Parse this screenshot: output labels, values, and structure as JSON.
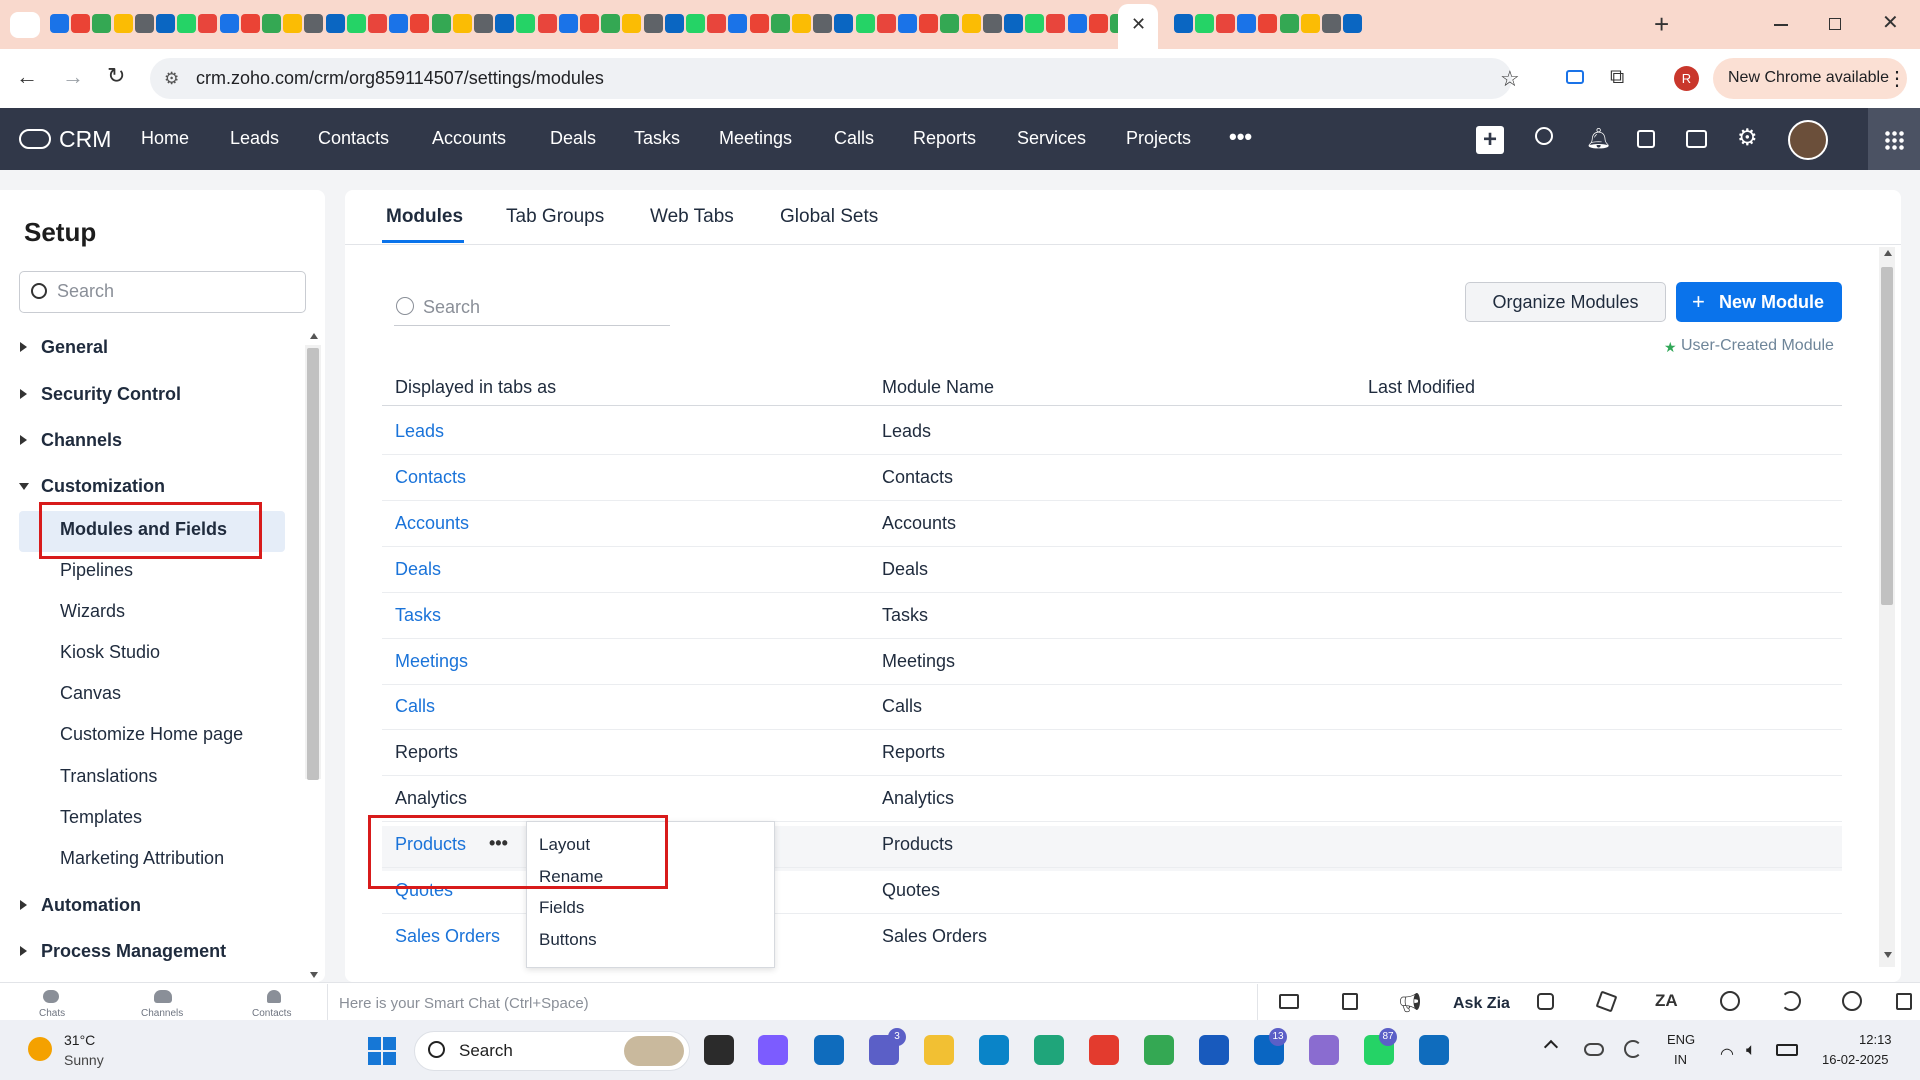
{
  "browser": {
    "url": "crm.zoho.com/crm/org859114507/settings/modules",
    "new_chrome_label": "New Chrome available",
    "profile_initial": "R"
  },
  "crm_nav": {
    "logo_text": "CRM",
    "items": [
      "Home",
      "Leads",
      "Contacts",
      "Accounts",
      "Deals",
      "Tasks",
      "Meetings",
      "Calls",
      "Reports",
      "Services",
      "Projects"
    ]
  },
  "sidebar": {
    "title": "Setup",
    "search_placeholder": "Search",
    "sections": {
      "general": "General",
      "security": "Security Control",
      "channels": "Channels",
      "customization": "Customization",
      "automation": "Automation",
      "process": "Process Management"
    },
    "customization_items": [
      "Modules and Fields",
      "Pipelines",
      "Wizards",
      "Kiosk Studio",
      "Canvas",
      "Customize Home page",
      "Translations",
      "Templates",
      "Marketing Attribution"
    ]
  },
  "main": {
    "tabs": [
      "Modules",
      "Tab Groups",
      "Web Tabs",
      "Global Sets"
    ],
    "search_placeholder": "Search",
    "organize_button": "Organize Modules",
    "new_module_button": "New Module",
    "user_created_legend": "User-Created Module",
    "table_headers": [
      "Displayed in tabs as",
      "Module Name",
      "Last Modified"
    ],
    "rows": [
      {
        "tab": "Leads",
        "module": "Leads"
      },
      {
        "tab": "Contacts",
        "module": "Contacts"
      },
      {
        "tab": "Accounts",
        "module": "Accounts"
      },
      {
        "tab": "Deals",
        "module": "Deals"
      },
      {
        "tab": "Tasks",
        "module": "Tasks"
      },
      {
        "tab": "Meetings",
        "module": "Meetings"
      },
      {
        "tab": "Calls",
        "module": "Calls"
      },
      {
        "tab": "Reports",
        "module": "Reports"
      },
      {
        "tab": "Analytics",
        "module": "Analytics"
      },
      {
        "tab": "Products",
        "module": "Products"
      },
      {
        "tab": "Quotes",
        "module": "Quotes"
      },
      {
        "tab": "Sales Orders",
        "module": "Sales Orders"
      }
    ],
    "row_menu": [
      "Layout",
      "Rename",
      "Fields",
      "Buttons"
    ]
  },
  "chatbar": {
    "labels": [
      "Chats",
      "Channels",
      "Contacts"
    ],
    "placeholder": "Here is your Smart Chat (Ctrl+Space)",
    "ask_zia": "Ask Zia"
  },
  "taskbar": {
    "weather_temp": "31°C",
    "weather_desc": "Sunny",
    "search_label": "Search",
    "badges": {
      "teams": "3",
      "linkedin": "13",
      "whatsapp": "87"
    },
    "language_line1": "ENG",
    "language_line2": "IN",
    "time": "12:13",
    "date": "16-02-2025"
  },
  "colors": {
    "nav_bg": "#313849",
    "accent": "#0a73eb",
    "link": "#1a73d9",
    "highlight_box": "#d81b1b"
  }
}
